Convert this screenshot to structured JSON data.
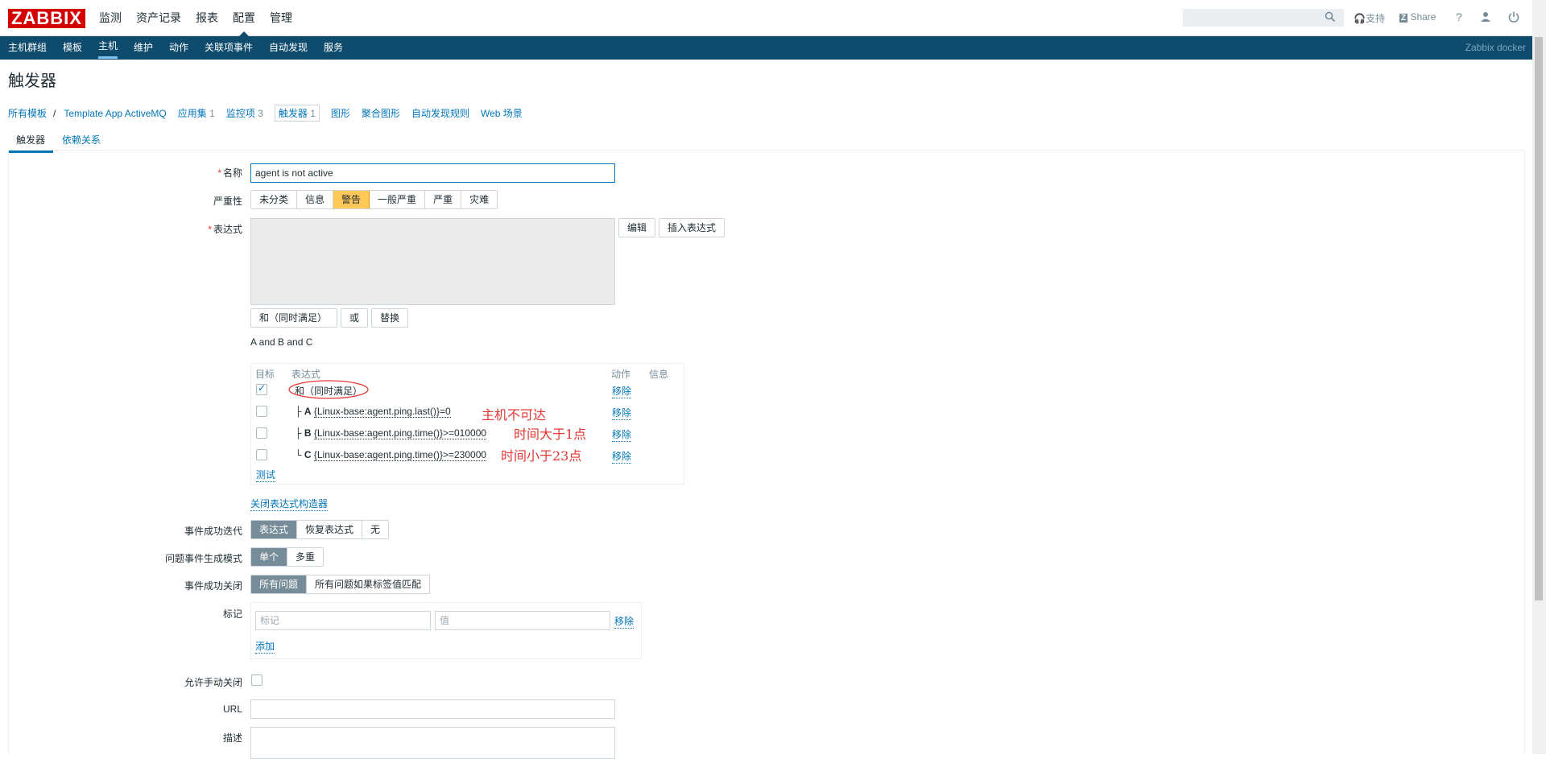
{
  "brand": "ZABBIX",
  "main_menu": [
    "监测",
    "资产记录",
    "报表",
    "配置",
    "管理"
  ],
  "top_right": {
    "support": "支持",
    "share": "Share",
    "help": "?"
  },
  "sub_menu": [
    "主机群组",
    "模板",
    "主机",
    "维护",
    "动作",
    "关联项事件",
    "自动发现",
    "服务"
  ],
  "instance_name": "Zabbix docker",
  "page_title": "触发器",
  "breadcrumbs": {
    "all_templates": "所有模板",
    "template": "Template App ActiveMQ",
    "apps": "应用集",
    "apps_count": "1",
    "items": "监控项",
    "items_count": "3",
    "triggers": "触发器",
    "triggers_count": "1",
    "graphs": "图形",
    "screens": "聚合图形",
    "discovery": "自动发现规则",
    "web": "Web 场景"
  },
  "tabs": [
    "触发器",
    "依赖关系"
  ],
  "form": {
    "name_label": "名称",
    "name_value": "agent is not active",
    "severity_label": "严重性",
    "severities": [
      "未分类",
      "信息",
      "警告",
      "一般严重",
      "严重",
      "灾难"
    ],
    "expression_label": "表达式",
    "edit_btn": "编辑",
    "insert_btn": "插入表达式",
    "and_btn": "和（同时满足）",
    "or_btn": "或",
    "replace_btn": "替换",
    "expression_text": "A and B and C",
    "table_headers": {
      "target": "目标",
      "expression": "表达式",
      "action": "动作",
      "info": "信息"
    },
    "rows": [
      {
        "prefix": "",
        "letter": "",
        "expr": "和（同时满足）",
        "action": "移除"
      },
      {
        "prefix": "├",
        "letter": "A",
        "expr": "{Linux-base:agent.ping.last()}=0",
        "action": "移除"
      },
      {
        "prefix": "├",
        "letter": "B",
        "expr": "{Linux-base:agent.ping.time()}>=010000",
        "action": "移除"
      },
      {
        "prefix": "└",
        "letter": "C",
        "expr": "{Linux-base:agent.ping.time()}>=230000",
        "action": "移除"
      }
    ],
    "annotations": [
      "主机不可达",
      "时间大于1点",
      "时间小于23点"
    ],
    "test_link": "测试",
    "close_builder": "关闭表达式构造器",
    "ok_event_label": "事件成功迭代",
    "ok_event_options": [
      "表达式",
      "恢复表达式",
      "无"
    ],
    "gen_mode_label": "问题事件生成模式",
    "gen_mode_options": [
      "单个",
      "多重"
    ],
    "ok_close_label": "事件成功关闭",
    "ok_close_options": [
      "所有问题",
      "所有问题如果标签值匹配"
    ],
    "tags_label": "标记",
    "tag_placeholder": "标记",
    "value_placeholder": "值",
    "tag_remove": "移除",
    "tag_add": "添加",
    "manual_close_label": "允许手动关闭",
    "url_label": "URL",
    "desc_label": "描述"
  }
}
